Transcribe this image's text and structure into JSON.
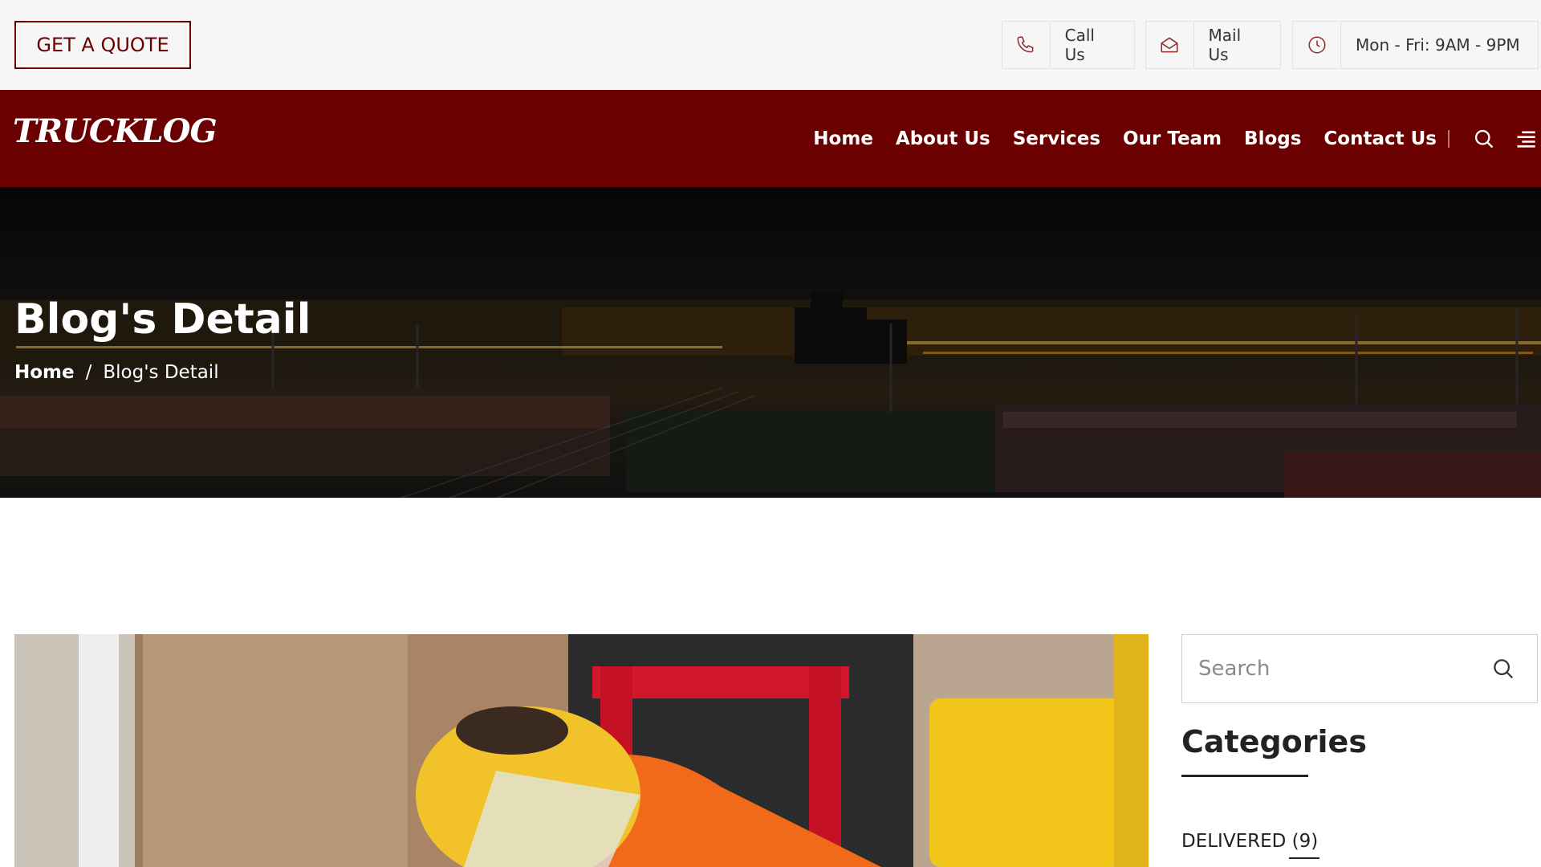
{
  "topbar": {
    "quote_label": "GET A QUOTE",
    "contacts": [
      {
        "icon": "phone-icon",
        "label": "Call Us"
      },
      {
        "icon": "mail-icon",
        "label": "Mail Us"
      },
      {
        "icon": "clock-icon",
        "label": "Mon - Fri: 9AM - 9PM"
      }
    ]
  },
  "nav": {
    "logo": "TRUCKLOG",
    "links": [
      "Home",
      "About Us",
      "Services",
      "Our Team",
      "Blogs",
      "Contact Us"
    ],
    "icons": [
      "search-icon",
      "menu-icon"
    ]
  },
  "hero": {
    "title": "Blog's Detail",
    "breadcrumb": {
      "home": "Home",
      "separator": "/",
      "current": "Blog's Detail"
    }
  },
  "sidebar": {
    "search_placeholder": "Search",
    "categories_title": "Categories",
    "categories": [
      {
        "label": "DELIVERED",
        "count": "(9)"
      }
    ]
  },
  "colors": {
    "brand": "#6b0000",
    "topbar_bg": "#f6f6f6",
    "text_dark": "#222222"
  }
}
